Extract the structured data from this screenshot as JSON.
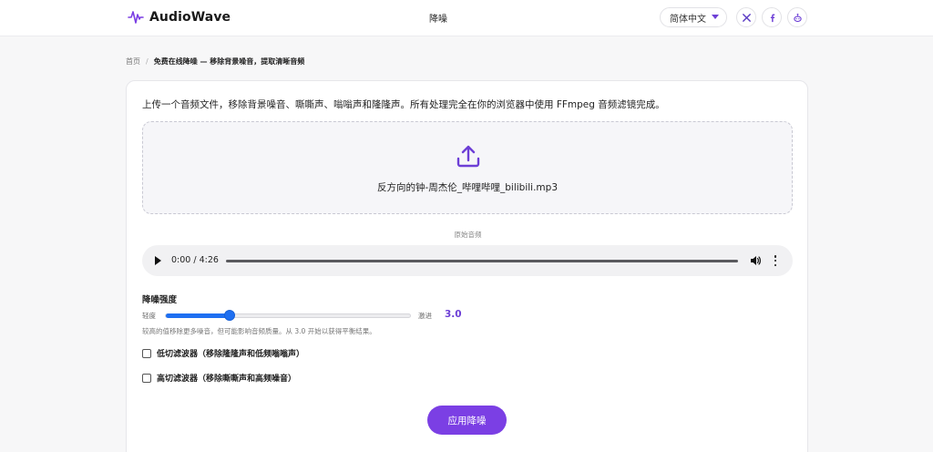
{
  "header": {
    "logo_text": "AudioWave",
    "nav_title": "降噪",
    "language": "简体中文",
    "social": [
      "x-icon",
      "facebook-icon",
      "reddit-icon"
    ],
    "brand_color": "#7b3fe4"
  },
  "breadcrumb": {
    "home": "首页",
    "separator": "/",
    "current": "免费在线降噪 — 移除背景噪音，提取清晰音频"
  },
  "main": {
    "intro": "上传一个音频文件，移除背景噪音、嘶嘶声、嗡嗡声和隆隆声。所有处理完全在你的浏览器中使用 FFmpeg 音频滤镜完成。",
    "file_name": "反方向的钟-周杰伦_哔哩哔哩_bilibili.mp3",
    "original_label": "原始音频",
    "player": {
      "time": "0:00 / 4:26",
      "progress_fraction": 0
    },
    "strength": {
      "title": "降噪强度",
      "min_label": "轻度",
      "max_label": "激进",
      "value": "3.0",
      "level_fraction": 0.26,
      "hint": "较高的值移除更多噪音，但可能影响音频质量。从 3.0 开始以获得平衡结果。"
    },
    "filters": [
      {
        "label": "低切滤波器（移除隆隆声和低频嗡嗡声）",
        "checked": false
      },
      {
        "label": "高切滤波器（移除嘶嘶声和高频噪音）",
        "checked": false
      }
    ],
    "apply_label": "应用降噪"
  }
}
